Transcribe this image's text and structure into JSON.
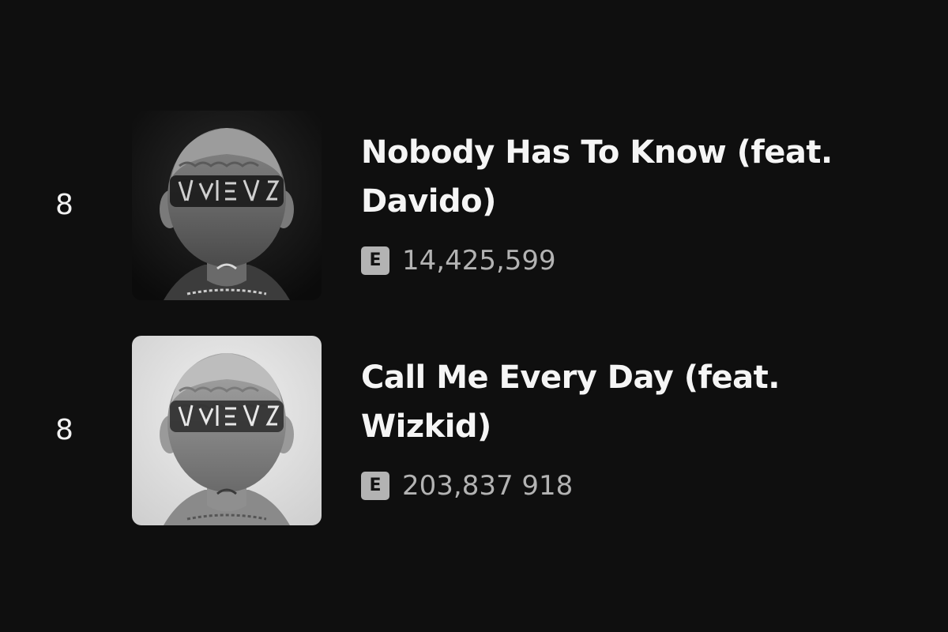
{
  "colors": {
    "background": "#0f0f0f",
    "title": "#f5f5f5",
    "secondary_text": "#b3b3b3",
    "badge_bg": "#b3b3b3",
    "cover_dark_bg": "#111111",
    "cover_light_bg": "#e2e2e2"
  },
  "tracks": [
    {
      "number": "8",
      "title": "Nobody Has To Know (feat. Davido)",
      "explicit_label": "E",
      "play_count": "14,425,599",
      "cover_style": "dark",
      "cover_icon": "album-cover-back-of-head-tattoo"
    },
    {
      "number": "8",
      "title": "Call Me Every Day (feat. Wizkid)",
      "explicit_label": "E",
      "play_count": "203,837 918",
      "cover_style": "light",
      "cover_icon": "album-cover-back-of-head-tattoo"
    }
  ]
}
